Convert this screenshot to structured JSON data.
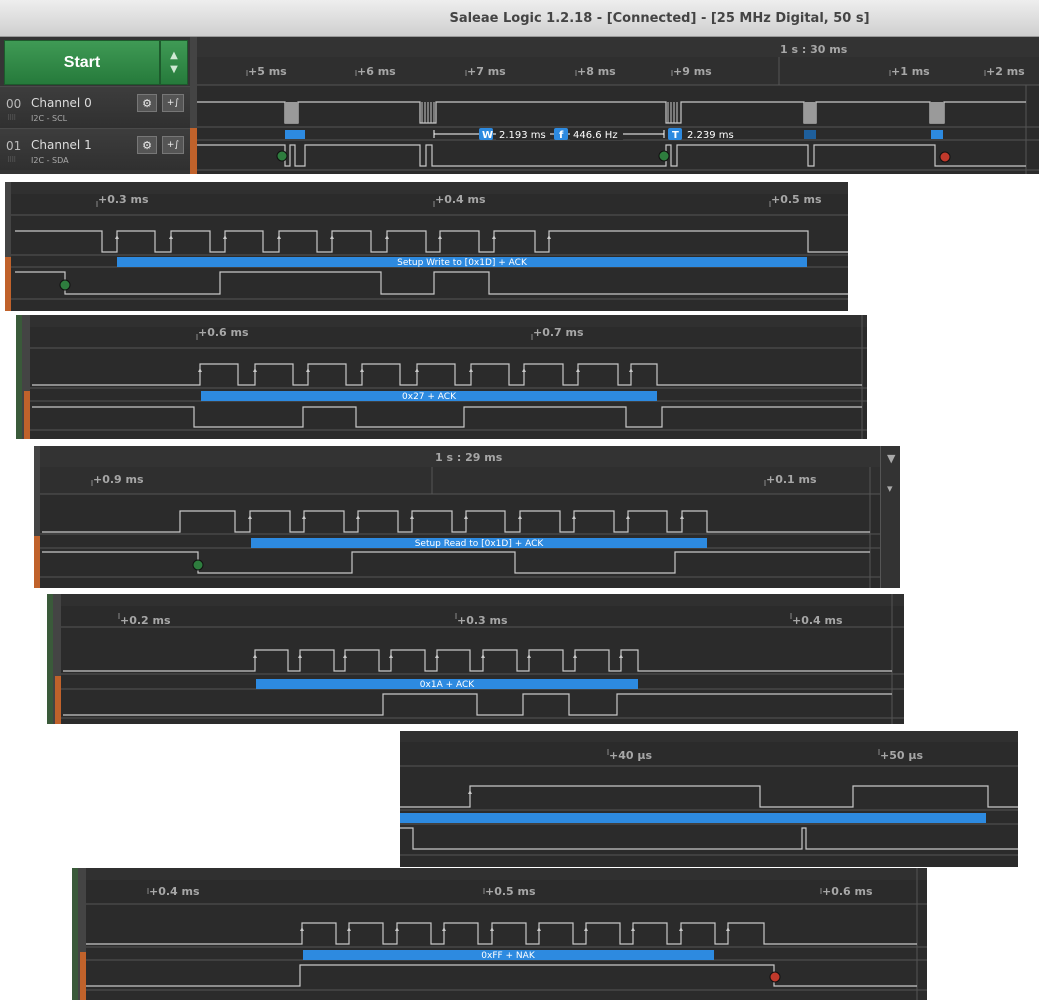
{
  "window": {
    "title": "Saleae Logic 1.2.18 - [Connected] - [25 MHz Digital, 50 s]"
  },
  "controls": {
    "start_label": "Start",
    "arrows_icon": "up-down-arrows-icon"
  },
  "channels": [
    {
      "num": "00",
      "name": "Channel 0",
      "analyzer": "I2C - SCL"
    },
    {
      "num": "01",
      "name": "Channel 1",
      "analyzer": "I2C - SDA"
    }
  ],
  "main_timeline": {
    "time_marker": "1 s : 30 ms",
    "ticks": [
      "+5 ms",
      "+6 ms",
      "+7 ms",
      "+8 ms",
      "+9 ms",
      "+1 ms",
      "+2 ms"
    ],
    "measurements": {
      "width": "2.193 ms",
      "frequency": "446.6 Hz",
      "period": "2.239 ms"
    },
    "measure_icons": [
      "W",
      "f",
      "T"
    ]
  },
  "zoom_panes": [
    {
      "ticks": [
        "+0.3 ms",
        "+0.4 ms",
        "+0.5 ms"
      ],
      "marker": "",
      "annotation": "Setup Write to [0x1D] + ACK"
    },
    {
      "ticks": [
        "+0.6 ms",
        "+0.7 ms"
      ],
      "marker": "",
      "annotation": "0x27 + ACK"
    },
    {
      "ticks": [
        "+0.9 ms",
        "+0.1 ms"
      ],
      "marker": "1 s : 29 ms",
      "annotation": "Setup Read to [0x1D] + ACK"
    },
    {
      "ticks": [
        "+0.2 ms",
        "+0.3 ms",
        "+0.4 ms"
      ],
      "marker": "",
      "annotation": "0x1A + ACK"
    },
    {
      "ticks": [
        "+40 µs",
        "+50 µs"
      ],
      "marker": "",
      "annotation": ""
    },
    {
      "ticks": [
        "+0.4 ms",
        "+0.5 ms",
        "+0.6 ms"
      ],
      "marker": "",
      "annotation": "0xFF + NAK"
    }
  ],
  "colors": {
    "background": "#2b2b2b",
    "signal": "#c8c8c8",
    "annotation": "#2d8ae0",
    "start_marker": "#2e7d3e",
    "stop_marker": "#c0392b",
    "start_button": "#2f8a45"
  }
}
